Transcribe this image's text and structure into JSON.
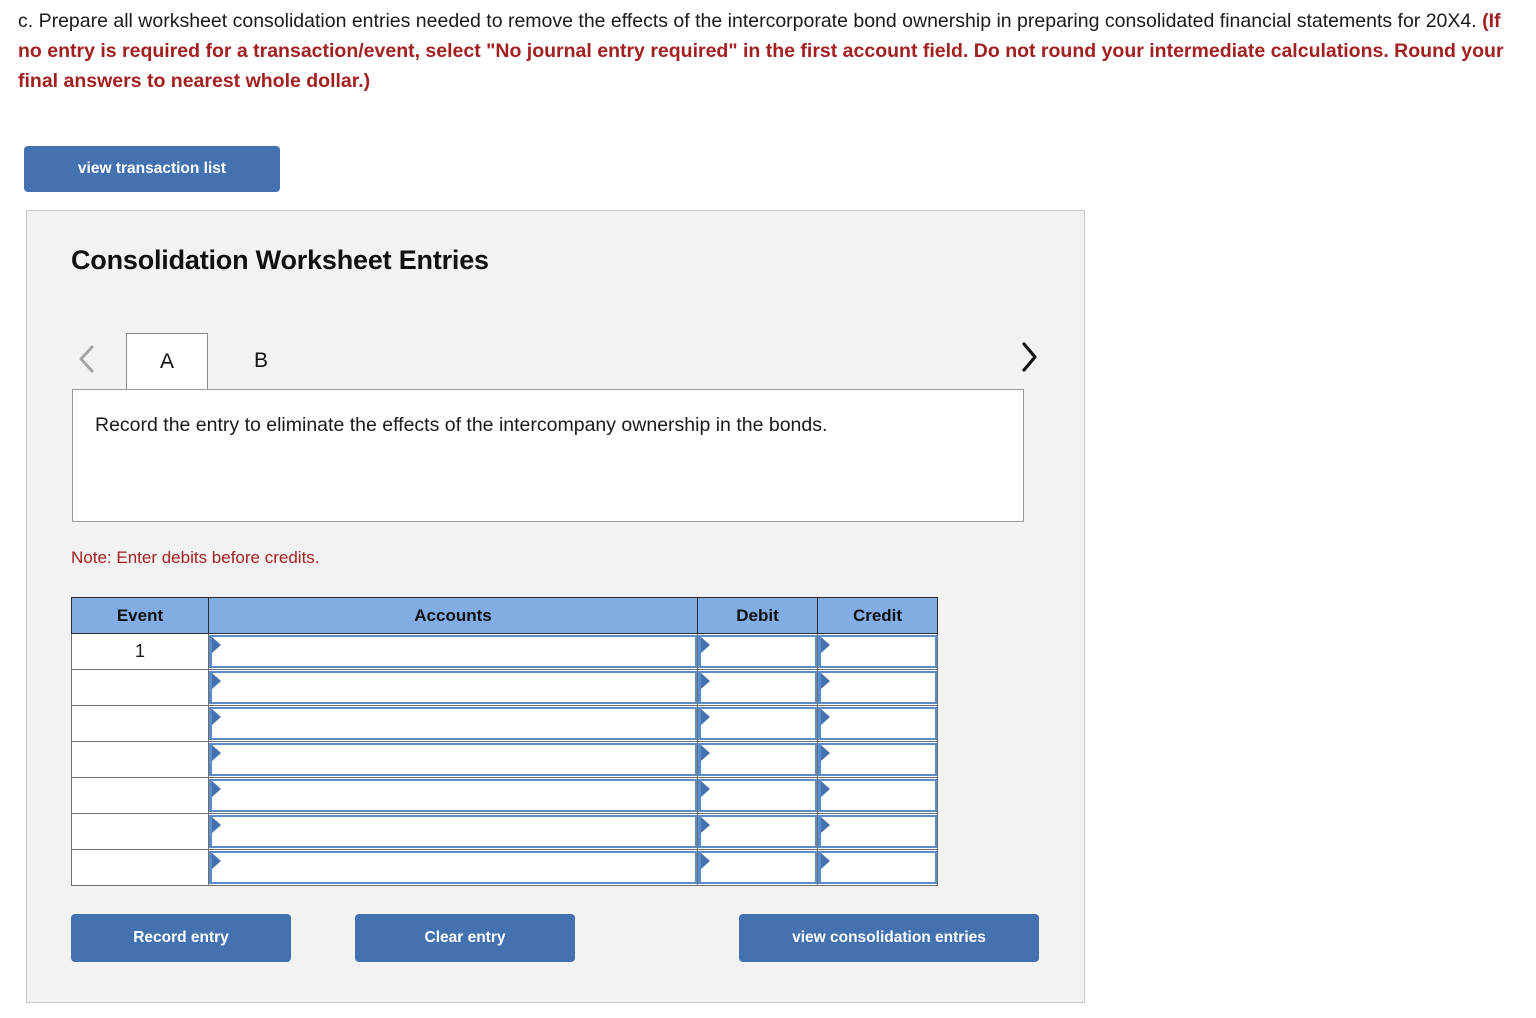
{
  "question": {
    "label": "c.",
    "plain_part_1": "c. Prepare all worksheet consolidation entries needed to remove the effects of the intercorporate bond ownership in preparing consolidated financial statements for 20X4. ",
    "emphasis_part": "(If no entry is required for a transaction/event, select \"No journal entry required\" in the first account field. Do not round your intermediate calculations. Round your final answers to nearest whole dollar.)",
    "emphasis_color": "#a32020"
  },
  "toolbar": {
    "view_transaction_list_label": "view transaction list"
  },
  "panel": {
    "title": "Consolidation Worksheet Entries",
    "background_color": "#f2f2f2"
  },
  "tabs": {
    "prev_icon": "chevron-left-icon",
    "next_icon": "chevron-right-icon",
    "items": [
      {
        "label": "A",
        "active": true
      },
      {
        "label": "B",
        "active": false
      }
    ]
  },
  "entry": {
    "description": "Record the entry to eliminate the effects of the intercompany ownership in the bonds.",
    "note": "Note: Enter debits before credits."
  },
  "journal": {
    "columns": [
      "Event",
      "Accounts",
      "Debit",
      "Credit"
    ],
    "rows": [
      {
        "event": "1",
        "account": "",
        "debit": "",
        "credit": ""
      },
      {
        "event": "",
        "account": "",
        "debit": "",
        "credit": ""
      },
      {
        "event": "",
        "account": "",
        "debit": "",
        "credit": ""
      },
      {
        "event": "",
        "account": "",
        "debit": "",
        "credit": ""
      },
      {
        "event": "",
        "account": "",
        "debit": "",
        "credit": ""
      },
      {
        "event": "",
        "account": "",
        "debit": "",
        "credit": ""
      },
      {
        "event": "",
        "account": "",
        "debit": "",
        "credit": ""
      }
    ],
    "header_color": "#82ace4",
    "input_border_color": "#5b8cc8"
  },
  "actions": {
    "record_entry_label": "Record entry",
    "clear_entry_label": "Clear entry",
    "view_consolidation_entries_label": "view consolidation entries",
    "button_color": "#4472b0"
  }
}
